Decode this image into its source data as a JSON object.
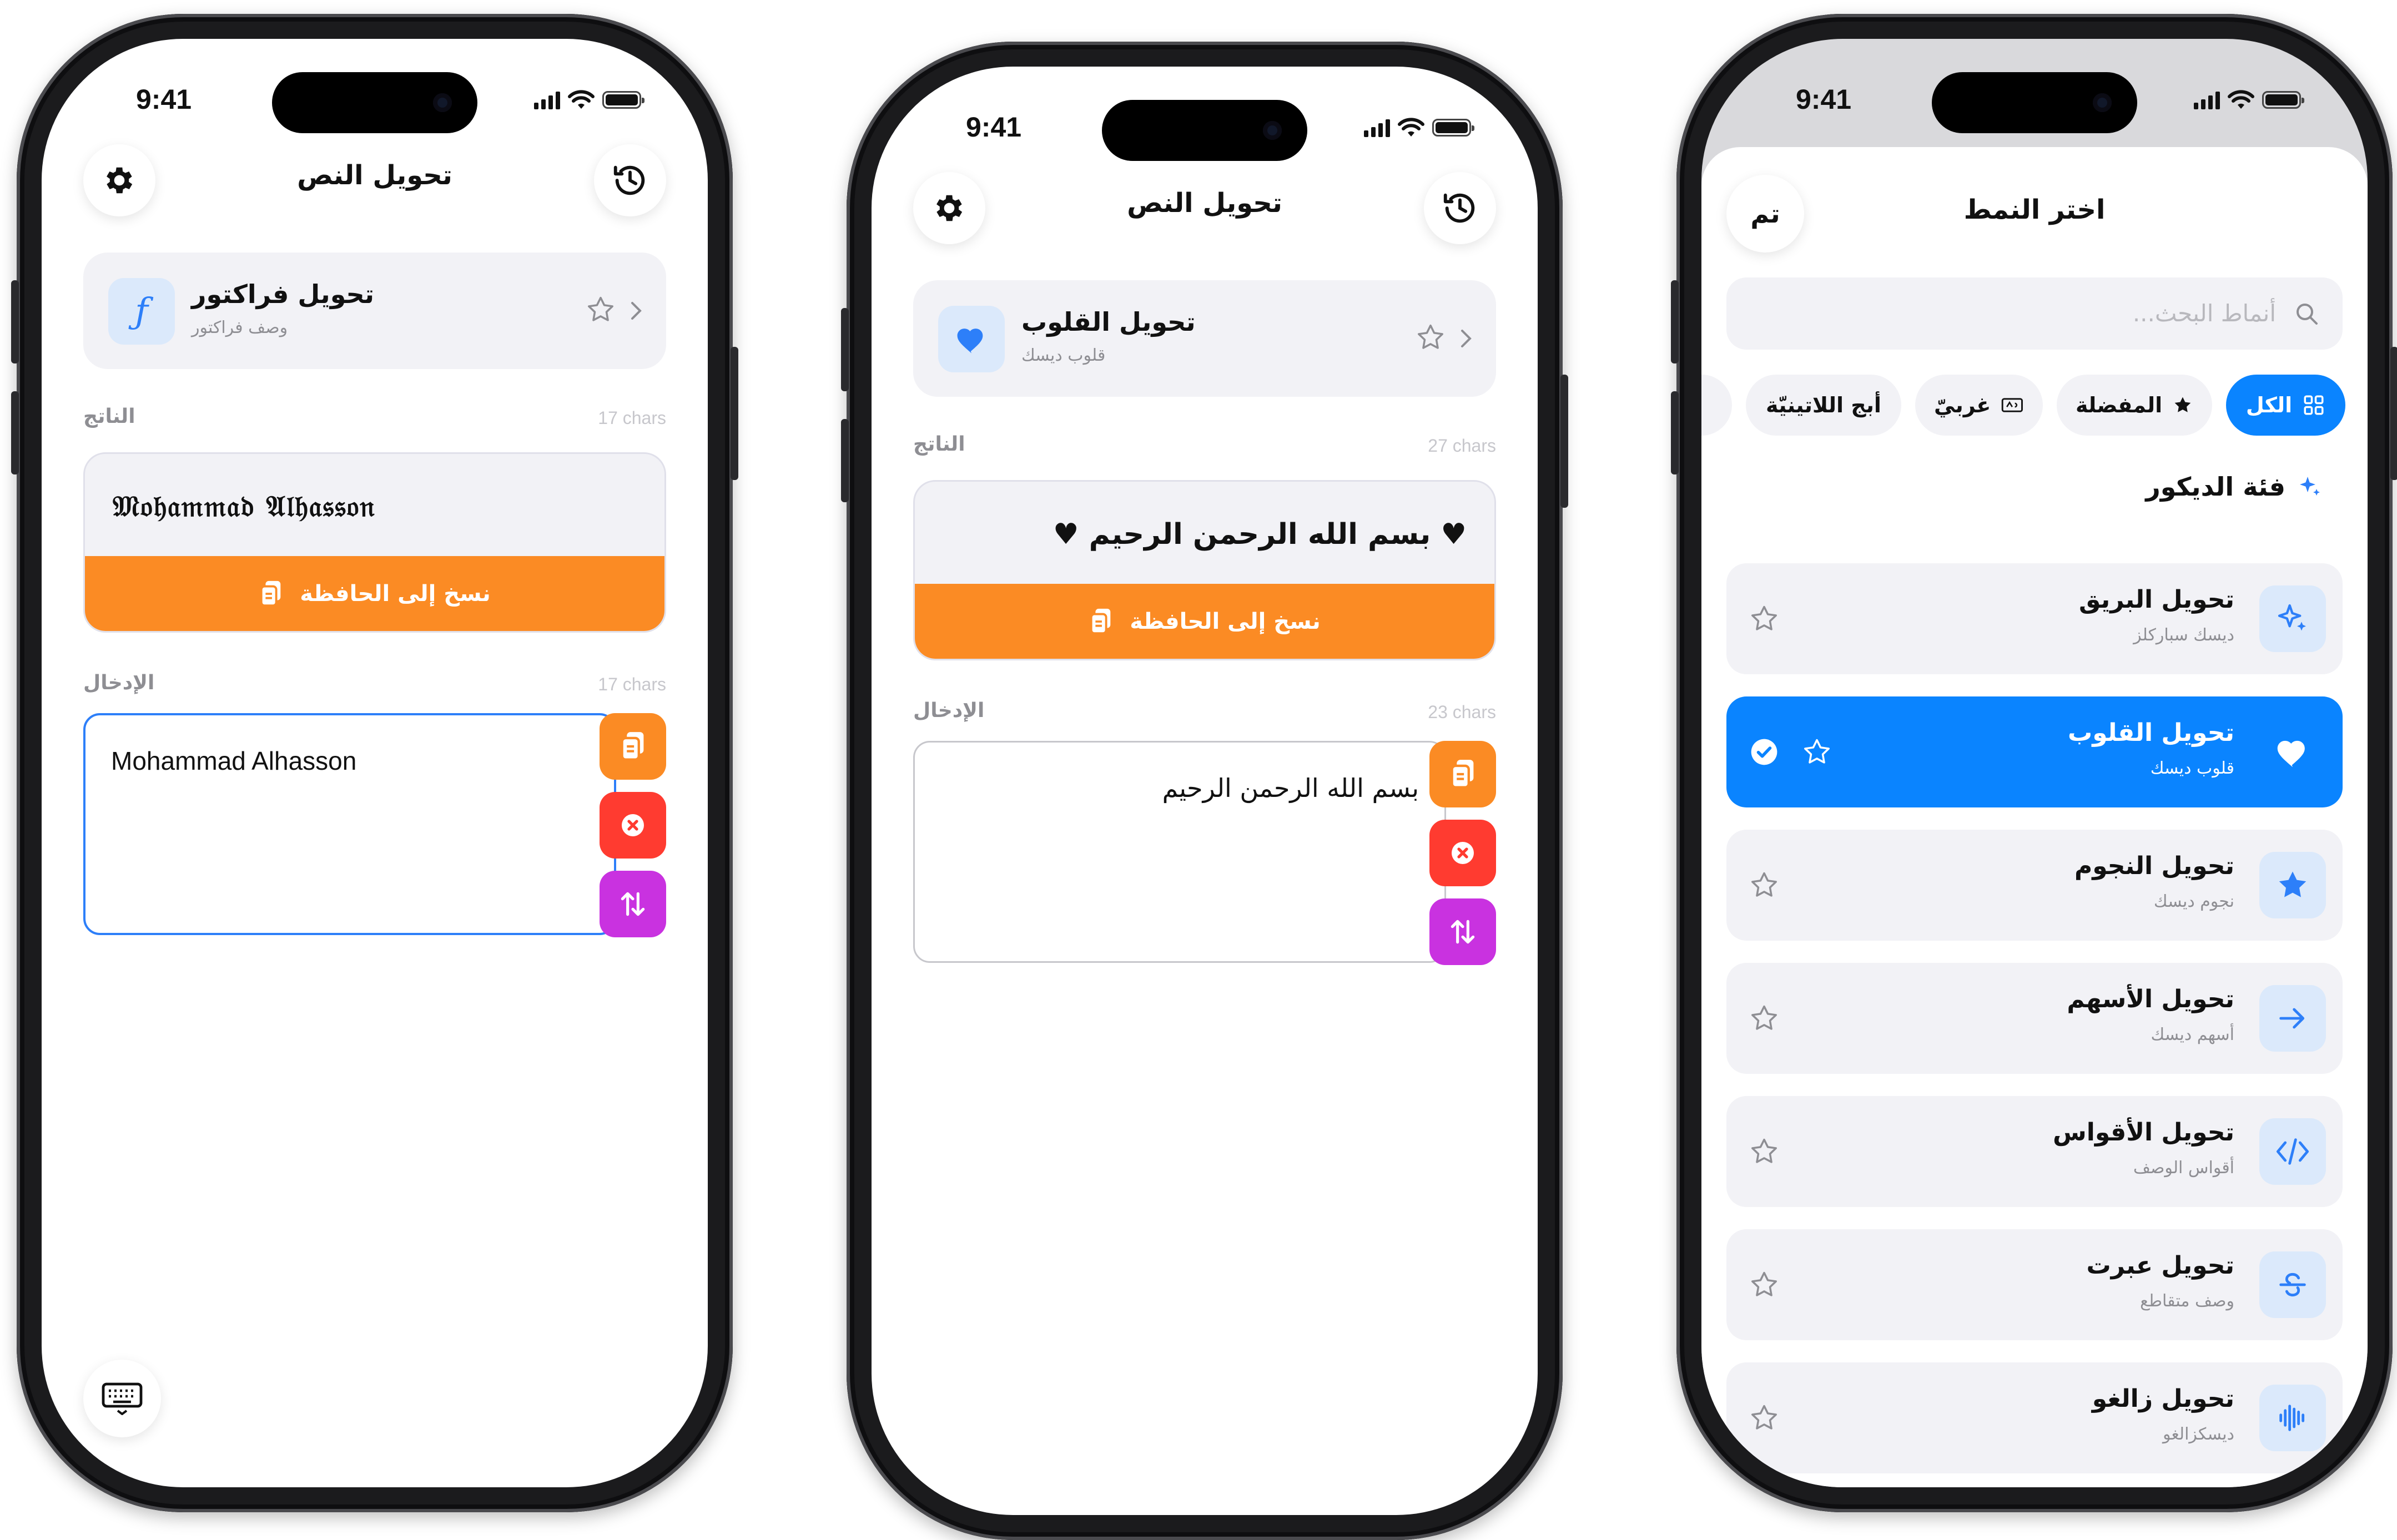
{
  "status": {
    "time": "9:41"
  },
  "nav_title": "تحويل النص",
  "labels": {
    "output": "الناتج",
    "input": "الإدخال",
    "copy": "نسخ إلى الحافظة"
  },
  "phone1": {
    "style_name": "تحويل فراكتور",
    "style_desc": "وصف فراكتور",
    "style_icon_glyph": "ƒ",
    "output_chars": "17 chars",
    "output_text": "𝔐𝔬𝔥𝔞𝔪𝔪𝔞𝔡 𝔄𝔩𝔥𝔞𝔰𝔰𝔬𝔫",
    "input_chars": "17 chars",
    "input_text": "Mohammad Alhasson"
  },
  "phone2": {
    "style_name": "تحويل القلوب",
    "style_desc": "قلوب ديسك",
    "output_chars": "27 chars",
    "output_text": "♥ بسم الله الرحمن الرحيم ♥",
    "input_chars": "23 chars",
    "input_text": "بسم الله الرحمن الرحيم"
  },
  "picker": {
    "title": "اختر النمط",
    "done": "تم",
    "search_placeholder": "أنماط البحث...",
    "chips": [
      {
        "label": "الكل",
        "icon": "grid-icon",
        "active": true
      },
      {
        "label": "المفضلة",
        "icon": "star-icon",
        "active": false
      },
      {
        "label": "غربيّ",
        "icon": "western-icon",
        "active": false
      },
      {
        "label": "أبج اللاتينيّة",
        "icon": "",
        "active": false
      }
    ],
    "category": "فئة الديكور",
    "rows": [
      {
        "name": "تحويل البريق",
        "desc": "ديسك سباركلز",
        "icon": "sparkles-icon",
        "selected": false
      },
      {
        "name": "تحويل القلوب",
        "desc": "قلوب ديسك",
        "icon": "heart-icon",
        "selected": true
      },
      {
        "name": "تحويل النجوم",
        "desc": "نجوم ديسك",
        "icon": "star-icon",
        "selected": false
      },
      {
        "name": "تحويل الأسهم",
        "desc": "أسهم ديسك",
        "icon": "arrow-right-icon",
        "selected": false
      },
      {
        "name": "تحويل الأقواس",
        "desc": "أقواس الوصف",
        "icon": "code-brackets-icon",
        "selected": false
      },
      {
        "name": "تحويل عبرت",
        "desc": "وصف متقاطع",
        "icon": "strikethrough-icon",
        "selected": false
      },
      {
        "name": "تحويل زالغو",
        "desc": "ديسكزالغو",
        "icon": "waveform-icon",
        "selected": false
      }
    ]
  },
  "colors": {
    "accent_blue": "#0a84ff",
    "copy_orange": "#fb8b24",
    "paste_orange": "#fb8b24",
    "clear_red": "#ff3b30",
    "swap_purple": "#c932e0"
  }
}
